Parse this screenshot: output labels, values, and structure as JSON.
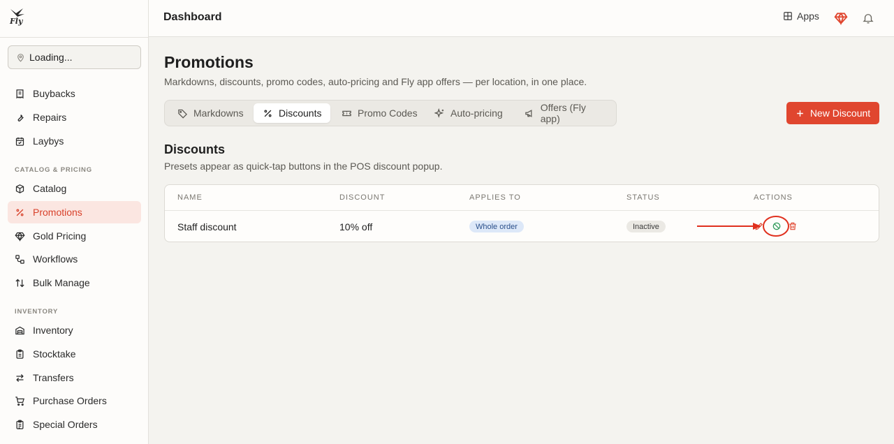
{
  "brand": {
    "logo_text": "Fly"
  },
  "sidebar": {
    "location": {
      "label": "Loading...",
      "icon": "map-pin-icon"
    },
    "items_top": [
      {
        "label": "Buybacks",
        "icon": "receipt-icon"
      },
      {
        "label": "Repairs",
        "icon": "wrench-icon"
      },
      {
        "label": "Laybys",
        "icon": "calendar-icon"
      }
    ],
    "section_catalog": "CATALOG & PRICING",
    "items_catalog": [
      {
        "label": "Catalog",
        "icon": "box-icon"
      },
      {
        "label": "Promotions",
        "icon": "percent-icon",
        "active": true
      },
      {
        "label": "Gold Pricing",
        "icon": "gem-icon"
      },
      {
        "label": "Workflows",
        "icon": "workflow-icon"
      },
      {
        "label": "Bulk Manage",
        "icon": "sort-arrows-icon"
      }
    ],
    "section_inventory": "INVENTORY",
    "items_inventory": [
      {
        "label": "Inventory",
        "icon": "warehouse-icon"
      },
      {
        "label": "Stocktake",
        "icon": "clipboard-icon"
      },
      {
        "label": "Transfers",
        "icon": "transfer-arrows-icon"
      },
      {
        "label": "Purchase Orders",
        "icon": "cart-icon"
      },
      {
        "label": "Special Orders",
        "icon": "clipboard-list-icon"
      }
    ]
  },
  "topbar": {
    "title": "Dashboard",
    "apps_label": "Apps"
  },
  "page": {
    "title": "Promotions",
    "subtitle": "Markdowns, discounts, promo codes, auto-pricing and Fly app offers — per location, in one place.",
    "tabs": [
      {
        "label": "Markdowns",
        "icon": "tag-icon"
      },
      {
        "label": "Discounts",
        "icon": "percent-icon",
        "active": true
      },
      {
        "label": "Promo Codes",
        "icon": "ticket-icon"
      },
      {
        "label": "Auto-pricing",
        "icon": "sparkles-icon"
      },
      {
        "label": "Offers (Fly app)",
        "icon": "megaphone-icon"
      }
    ],
    "new_button": "New Discount"
  },
  "discounts": {
    "title": "Discounts",
    "subtitle": "Presets appear as quick-tap buttons in the POS discount popup.",
    "columns": [
      "NAME",
      "DISCOUNT",
      "APPLIES TO",
      "STATUS",
      "ACTIONS"
    ],
    "rows": [
      {
        "name": "Staff discount",
        "discount": "10% off",
        "applies_to": "Whole order",
        "status": "Inactive"
      }
    ]
  },
  "colors": {
    "accent": "#e0462f",
    "active_bg": "#fbe6e1",
    "annotation": "#e0301e"
  }
}
